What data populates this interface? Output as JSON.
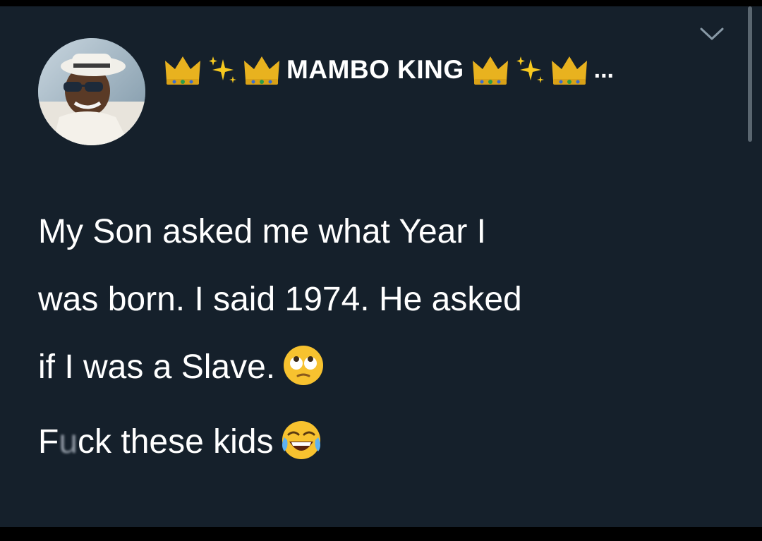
{
  "tweet": {
    "display_name": "MAMBO KING",
    "name_prefix_icons": [
      "crown-emoji",
      "sparkles-emoji",
      "crown-emoji"
    ],
    "name_suffix_icons": [
      "crown-emoji",
      "sparkles-emoji",
      "crown-emoji"
    ],
    "name_ellipsis": "...",
    "text_lines": [
      "My Son asked me what Year I",
      "was born. I said 1974.  He asked",
      "if I was a Slave."
    ],
    "last_line_start": "F",
    "last_line_censored": "u",
    "last_line_end": "ck these kids",
    "emoji_after_line3": "face-with-rolling-eyes-emoji",
    "emoji_after_last_line": "face-with-tears-of-joy-emoji"
  },
  "colors": {
    "background": "#15202b",
    "text": "#ffffff",
    "outer_bar": "#000000"
  }
}
